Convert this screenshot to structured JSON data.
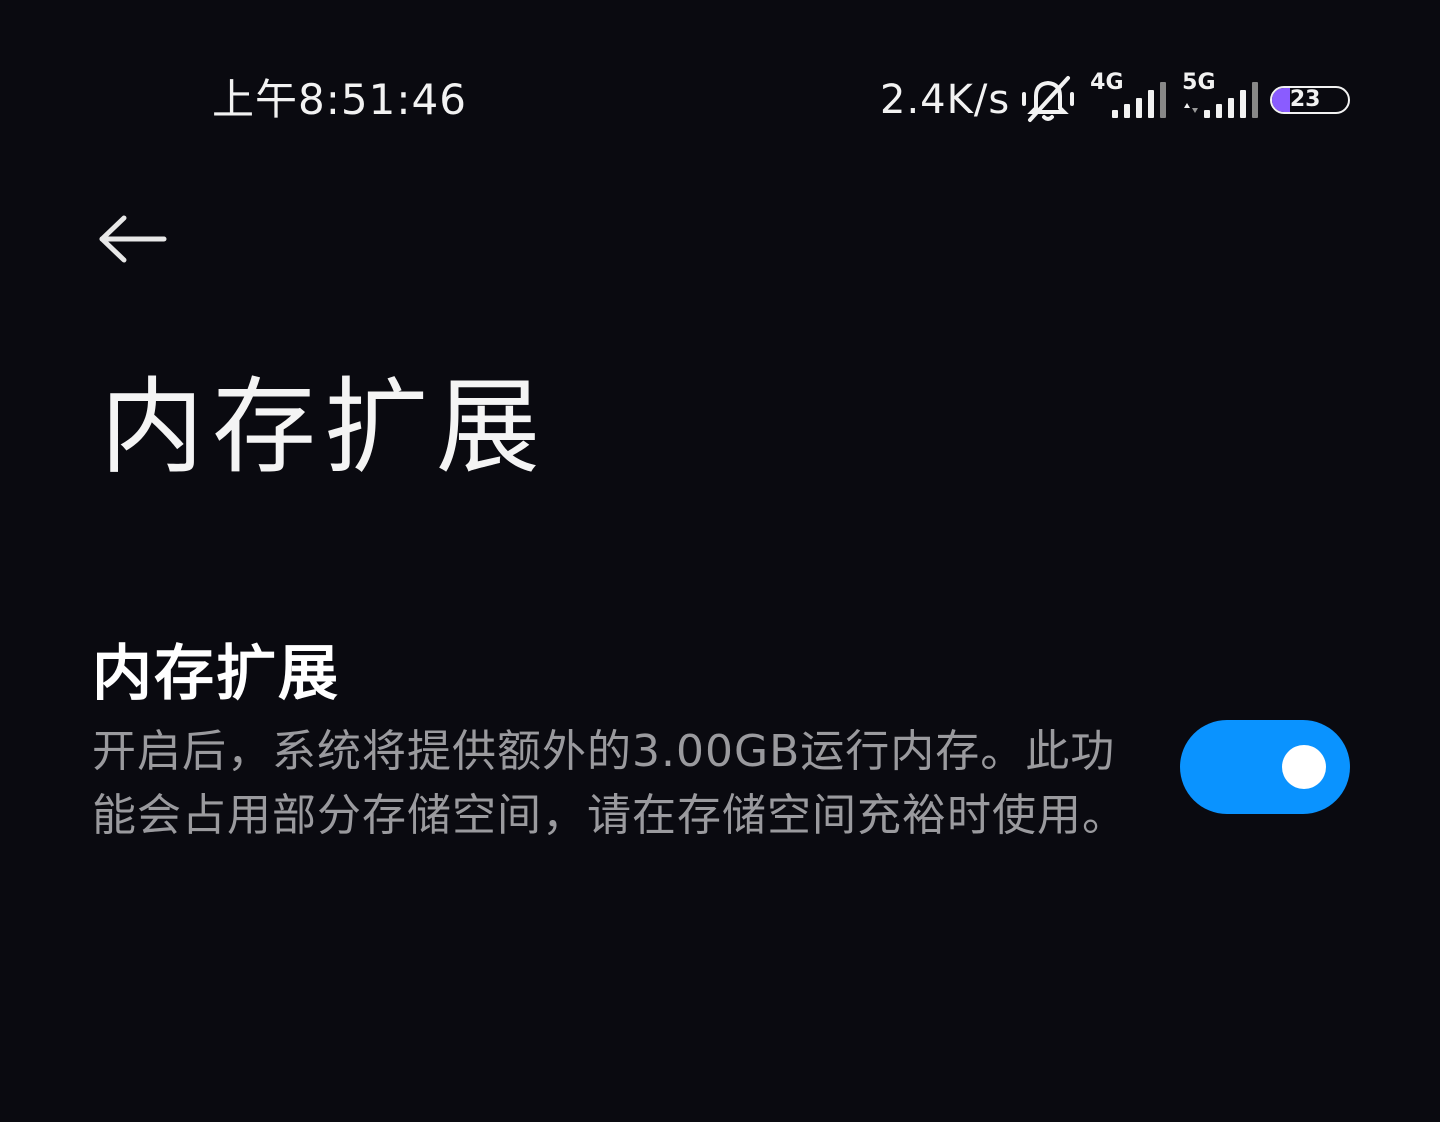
{
  "status_bar": {
    "time": "上午8:51:46",
    "network_speed": "2.4K/s",
    "mute_icon": "bell-muted-icon",
    "signal_1_label": "4G",
    "signal_2_label": "5G",
    "battery_level": "23",
    "battery_color": "#8a5cff"
  },
  "header": {
    "back_icon": "arrow-left-icon",
    "title": "内存扩展"
  },
  "setting": {
    "title": "内存扩展",
    "description": "开启后，系统将提供额外的3.00GB运行内存。此功能会占用部分存储空间，请在存储空间充裕时使用。",
    "toggle_on": true,
    "toggle_color": "#0a93ff"
  }
}
